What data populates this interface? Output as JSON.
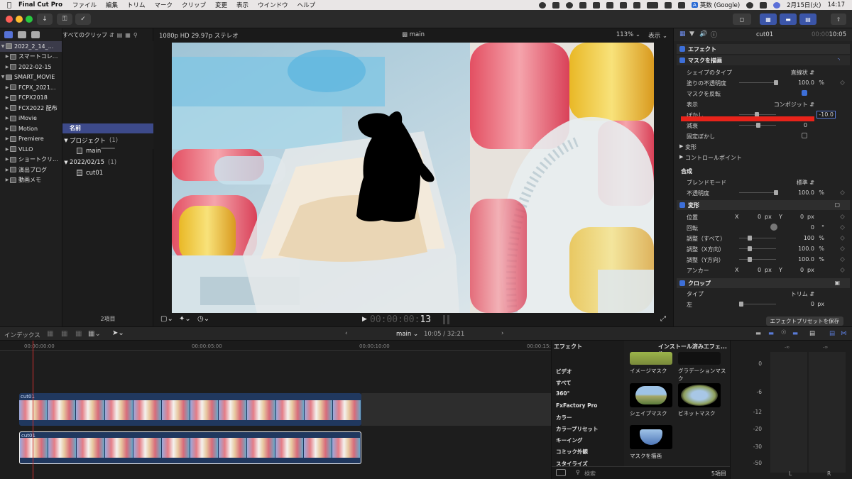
{
  "menubar": {
    "app_name": "Final Cut Pro",
    "menus": [
      "ファイル",
      "編集",
      "トリム",
      "マーク",
      "クリップ",
      "変更",
      "表示",
      "ウインドウ",
      "ヘルプ"
    ],
    "input_source": "英数 (Google)",
    "date": "2月15日(火)",
    "time": "14:17"
  },
  "library": {
    "rows": [
      {
        "label": "2022_2_14_...",
        "indent": 0,
        "selected": true
      },
      {
        "label": "スマートコレ...",
        "indent": 1,
        "selected": false
      },
      {
        "label": "2022-02-15",
        "indent": 1,
        "selected": false
      },
      {
        "label": "SMART_MOVIE",
        "indent": 0,
        "selected": false
      },
      {
        "label": "FCPX_2021...",
        "indent": 1,
        "selected": false
      },
      {
        "label": "FCPX2018",
        "indent": 1,
        "selected": false
      },
      {
        "label": "FCX2022 配布",
        "indent": 1,
        "selected": false
      },
      {
        "label": "iMovie",
        "indent": 1,
        "selected": false
      },
      {
        "label": "Motion",
        "indent": 1,
        "selected": false
      },
      {
        "label": "Premiere",
        "indent": 1,
        "selected": false
      },
      {
        "label": "VLLO",
        "indent": 1,
        "selected": false
      },
      {
        "label": "ショートクリ...",
        "indent": 1,
        "selected": false
      },
      {
        "label": "演出ブログ",
        "indent": 1,
        "selected": false
      },
      {
        "label": "動画メモ",
        "indent": 1,
        "selected": false
      }
    ]
  },
  "browser": {
    "filter": "すべてのクリップ",
    "column_header": "名前",
    "group_project": "プロジェクト",
    "group_project_count": "(1)",
    "project_item": "main",
    "group_date": "2022/02/15",
    "group_date_count": "(1)",
    "clip_item": "cut01",
    "footer": "2項目"
  },
  "viewer": {
    "format": "1080p HD 29.97p ステレオ",
    "title": "main",
    "zoom": "113%",
    "view_menu": "表示",
    "timecode_dim": "00:00:00:",
    "timecode_bright": "13"
  },
  "inspector": {
    "clip_name": "cut01",
    "clip_time_dim": "00:00",
    "clip_time": "10:05",
    "effects_section": "エフェクト",
    "mask_effect": "マスクを描画",
    "shape_type_label": "シェイプのタイプ",
    "shape_type_value": "直線状",
    "fill_opacity_label": "塗りの不透明度",
    "fill_opacity_value": "100.0",
    "pct": "%",
    "invert_label": "マスクを反転",
    "display_label": "表示",
    "display_value": "コンポジット",
    "feather_label": "ぼかし",
    "feather_value": "-10.0",
    "falloff_label": "減衰",
    "falloff_value": "0",
    "fixed_feather_label": "固定ぼかし",
    "transform_sub": "変形",
    "control_points": "コントロールポイント",
    "composite_section": "合成",
    "blend_label": "ブレンドモード",
    "blend_value": "標準",
    "opacity_label": "不透明度",
    "opacity_value": "100.0",
    "transform_section": "変形",
    "position_label": "位置",
    "x_label": "X",
    "y_label": "Y",
    "position_x": "0",
    "position_y": "0",
    "px": "px",
    "rotation_label": "回転",
    "rotation_value": "0",
    "deg": "°",
    "scale_all_label": "調整（すべて）",
    "scale_all_value": "100",
    "scale_x_label": "調整（X方向）",
    "scale_x_value": "100.0",
    "scale_y_label": "調整（Y方向）",
    "scale_y_value": "100.0",
    "anchor_label": "アンカー",
    "anchor_x": "0",
    "anchor_y": "0",
    "crop_section": "クロップ",
    "crop_type_label": "タイプ",
    "crop_type_value": "トリム",
    "crop_left_label": "左",
    "crop_left_value": "0",
    "save_preset": "エフェクトプリセットを保存",
    "highlight_color": "#e8231a"
  },
  "timeline_bar": {
    "index": "インデックス",
    "project": "main",
    "duration": "10:05 / 32:21"
  },
  "timeline": {
    "ruler": [
      "00:00:00:00",
      "00:00:05:00",
      "00:00:10:00",
      "00:00:15:"
    ],
    "clip_upper": "cut01",
    "clip_lower": "cut01"
  },
  "effects": {
    "title": "エフェクト",
    "selector": "インストール済みエフェ...",
    "categories": [
      "ビデオ",
      "すべて",
      "360°",
      "FxFactory Pro",
      "カラー",
      "カラープリセット",
      "キーイング",
      "コミック外観",
      "スタイライズ"
    ],
    "items": [
      "イメージマスク",
      "グラデーションマスク",
      "シェイプマスク",
      "ビネットマスク",
      "マスクを描画"
    ],
    "search_placeholder": "検索",
    "count": "5項目"
  },
  "meters": {
    "scale": [
      "-∞",
      "0",
      "-6",
      "-12",
      "-20",
      "-30",
      "-50"
    ],
    "left": "L",
    "right": "R"
  }
}
